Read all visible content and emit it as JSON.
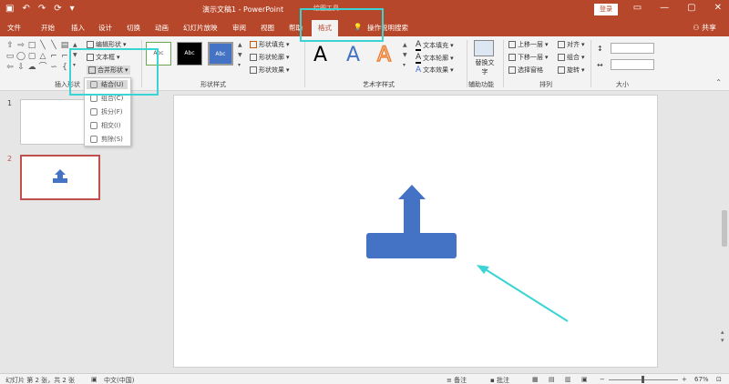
{
  "window": {
    "title": "演示文稿1 - PowerPoint",
    "context_group": "绘图工具",
    "login": "登录",
    "controls": [
      "—",
      "▢",
      "✕"
    ]
  },
  "tabs": [
    "文件",
    "开始",
    "插入",
    "设计",
    "切换",
    "动画",
    "幻灯片放映",
    "审阅",
    "视图",
    "帮助",
    "格式",
    "操作说明搜索"
  ],
  "share": "共享",
  "ribbon": {
    "insert_shapes": {
      "edit_shape": "编辑形状",
      "text_box": "文本框",
      "merge_shapes": "合并形状",
      "label": "插入形状"
    },
    "shape_styles": {
      "samples": [
        "Abc",
        "Abc",
        "Abc"
      ],
      "fill": "形状填充",
      "outline": "形状轮廓",
      "effects": "形状效果",
      "label": "形状样式"
    },
    "wordart": {
      "letters": [
        "A",
        "A",
        "A"
      ],
      "text_fill": "文本填充",
      "text_outline": "文本轮廓",
      "text_effects": "文本效果",
      "label": "艺术字样式"
    },
    "accessibility": {
      "alt_text": "替换文字",
      "label": "辅助功能"
    },
    "arrange": {
      "bring_forward": "上移一层",
      "send_backward": "下移一层",
      "selection_pane": "选择窗格",
      "align": "对齐",
      "group": "组合",
      "rotate": "旋转",
      "label": "排列"
    },
    "size": {
      "label": "大小"
    }
  },
  "merge_menu": [
    {
      "label": "结合(U)",
      "highlighted": true
    },
    {
      "label": "组合(C)",
      "highlighted": false
    },
    {
      "label": "拆分(F)",
      "highlighted": false
    },
    {
      "label": "相交(I)",
      "highlighted": false
    },
    {
      "label": "剪除(S)",
      "highlighted": false
    }
  ],
  "slides": [
    {
      "number": "1"
    },
    {
      "number": "2"
    }
  ],
  "status": {
    "slide_info": "幻灯片 第 2 张，共 2 张",
    "language": "中文(中国)",
    "notes": "备注",
    "comments": "批注",
    "zoom": "67%"
  },
  "colors": {
    "accent": "#b7472a",
    "shape_fill": "#4472c4",
    "highlight": "#3ad4d4"
  }
}
